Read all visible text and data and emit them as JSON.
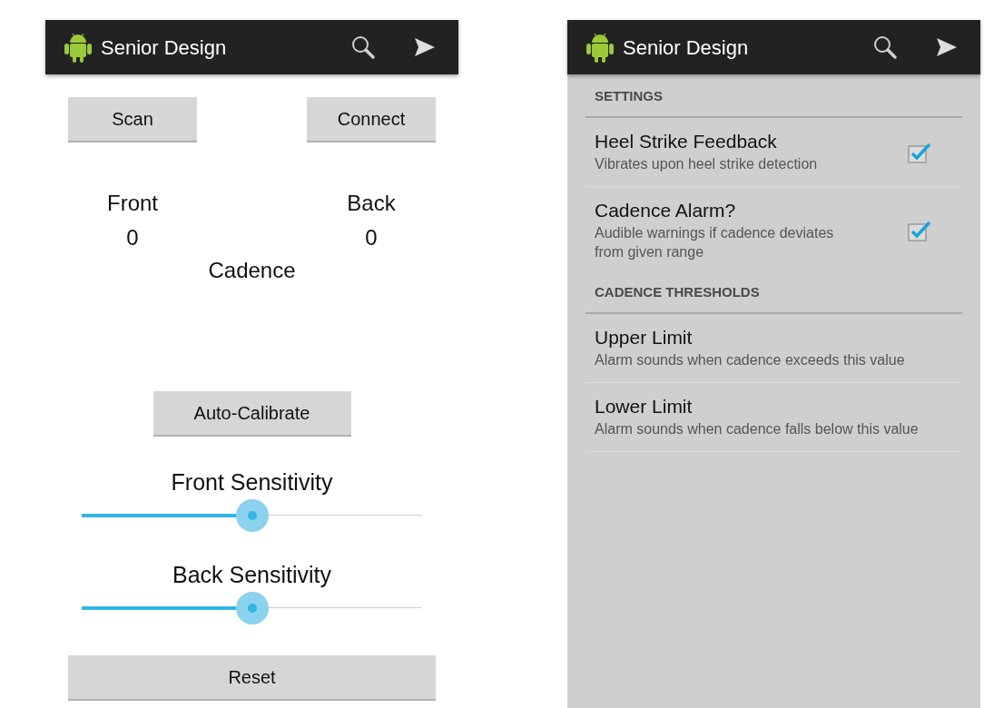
{
  "main_screen": {
    "action_bar": {
      "title": "Senior Design"
    },
    "top_buttons": [
      "Scan",
      "Connect"
    ],
    "counters": [
      {
        "label": "Front",
        "value": "0"
      },
      {
        "label": "Back",
        "value": "0"
      }
    ],
    "cadence_label": "Cadence",
    "calibrate_button": "Auto-Calibrate",
    "sliders": [
      {
        "label": "Front Sensitivity",
        "level": 0.5
      },
      {
        "label": "Back Sensitivity",
        "level": 0.5
      }
    ],
    "reset_button": "Reset"
  },
  "settings_screen": {
    "action_bar": {
      "title": "Senior Design"
    },
    "sections": [
      {
        "header": "SETTINGS",
        "items": [
          {
            "kind": "checkbox",
            "title": "Heel Strike Feedback",
            "summary": "Vibrates upon heel strike detection",
            "checked": true
          },
          {
            "kind": "checkbox",
            "title": "Cadence Alarm?",
            "summary": "Audible warnings if cadence deviates from given range",
            "checked": true
          }
        ]
      },
      {
        "header": "CADENCE THRESHOLDS",
        "items": [
          {
            "kind": "plain",
            "title": "Upper Limit",
            "summary": "Alarm sounds when cadence exceeds this value"
          },
          {
            "kind": "plain",
            "title": "Lower Limit",
            "summary": "Alarm sounds when cadence falls below this value"
          }
        ]
      }
    ]
  }
}
